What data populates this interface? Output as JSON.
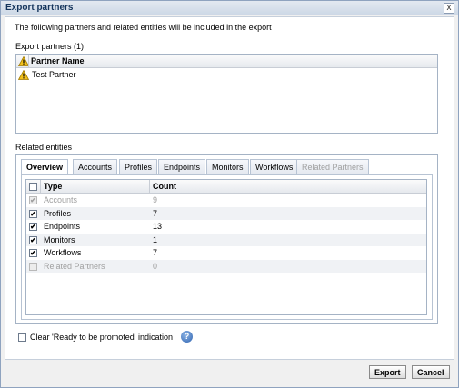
{
  "dialog": {
    "title": "Export partners",
    "close_glyph": "x"
  },
  "intro": "The following partners and related entities will be included in the export",
  "partners": {
    "label": "Export partners (1)",
    "column": "Partner Name",
    "rows": [
      {
        "name": "Test Partner",
        "icon": "warning-icon"
      }
    ]
  },
  "related": {
    "label": "Related entities",
    "tabs": [
      {
        "label": "Overview",
        "state": "active"
      },
      {
        "label": "Accounts",
        "state": "normal"
      },
      {
        "label": "Profiles",
        "state": "normal"
      },
      {
        "label": "Endpoints",
        "state": "normal"
      },
      {
        "label": "Monitors",
        "state": "normal"
      },
      {
        "label": "Workflows",
        "state": "normal"
      },
      {
        "label": "Related Partners",
        "state": "disabled"
      }
    ],
    "columns": {
      "type": "Type",
      "count": "Count"
    },
    "rows": [
      {
        "type": "Accounts",
        "count": "9",
        "checked": true,
        "disabled": true
      },
      {
        "type": "Profiles",
        "count": "7",
        "checked": true,
        "disabled": false
      },
      {
        "type": "Endpoints",
        "count": "13",
        "checked": true,
        "disabled": false
      },
      {
        "type": "Monitors",
        "count": "1",
        "checked": true,
        "disabled": false
      },
      {
        "type": "Workflows",
        "count": "7",
        "checked": true,
        "disabled": false
      },
      {
        "type": "Related Partners",
        "count": "0",
        "checked": false,
        "disabled": true
      }
    ]
  },
  "clear_option": {
    "label": "Clear 'Ready to be promoted' indication",
    "checked": false,
    "help_glyph": "?"
  },
  "buttons": {
    "export": "Export",
    "cancel": "Cancel"
  },
  "check_glyph": "✔",
  "colors": {
    "warning": "#f2c11c",
    "accent": "#15355c"
  }
}
